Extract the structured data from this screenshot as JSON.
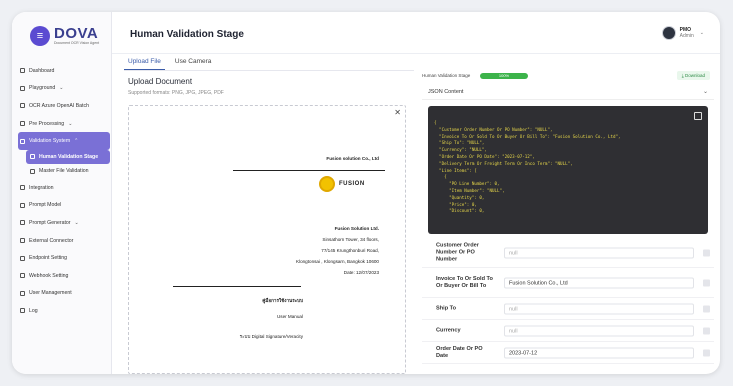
{
  "app": {
    "logo_mark": "≡",
    "logo_name": "DOVA",
    "logo_tag": "Document OCR Vision Agent"
  },
  "sidebar": {
    "items": [
      {
        "label": "Dashboard",
        "icon": "dashboard-icon"
      },
      {
        "label": "Playground",
        "icon": "playground-icon",
        "chevron": "⌄"
      },
      {
        "label": "OCR Azure OpenAI Batch",
        "icon": "batch-icon"
      },
      {
        "label": "Pre Processing",
        "icon": "preprocessing-icon",
        "chevron": "⌄"
      },
      {
        "label": "Validation System",
        "icon": "validation-icon",
        "chevron": "⌃"
      },
      {
        "label": "Human Validation Stage",
        "icon": "human-validation-icon"
      },
      {
        "label": "Master File Validation",
        "icon": "master-file-icon"
      },
      {
        "label": "Integration",
        "icon": "integration-icon"
      },
      {
        "label": "Prompt Model",
        "icon": "prompt-model-icon"
      },
      {
        "label": "Prompt Generator",
        "icon": "prompt-generator-icon",
        "chevron": "⌄"
      },
      {
        "label": "External Connector",
        "icon": "connector-icon"
      },
      {
        "label": "Endpoint Setting",
        "icon": "endpoint-icon"
      },
      {
        "label": "Webhook Setting",
        "icon": "webhook-icon"
      },
      {
        "label": "User Management",
        "icon": "user-icon"
      },
      {
        "label": "Log",
        "icon": "log-icon"
      }
    ]
  },
  "header": {
    "title": "Human Validation Stage",
    "user_name": "PMO",
    "user_role": "Admin",
    "chevron": "⌄"
  },
  "tabs": [
    {
      "label": "Upload File"
    },
    {
      "label": "Use Camera"
    }
  ],
  "upload": {
    "title": "Upload Document",
    "subtitle": "Supported formats: PNG, JPG, JPEG, PDF",
    "close": "✕"
  },
  "document": {
    "company_top": "Fusion solution Co., Ltd",
    "logo_text": "FUSION",
    "company": "Fusion Solution Ltd.",
    "addr1": "Sinsathorn Tower, 34 floors,",
    "addr2": "77/145 Krungthonburi Road,",
    "addr3": "Klongtonsai , Klongsarn, Bangkok 10600",
    "date": "Date: 12/07/2023",
    "thai_title": "คู่มือการใช้งานระบบ",
    "manual": "User Manual",
    "system": "ระบบ Digital Signature/Veracity"
  },
  "right": {
    "stage_label": "Human Validation Stage",
    "progress": "100%",
    "download": "Download",
    "json_title": "JSON Content",
    "json_chev": "⌄",
    "json_text": "{\n  \"Customer Order Number Or PO Number\": \"NULL\",\n  \"Invoice To Or Sold To Or Buyer Or Bill To\": \"Fusion Solution Co., Ltd\",\n  \"Ship To\": \"NULL\",\n  \"Currency\": \"NULL\",\n  \"Order Date Or PO Date\": \"2023-07-12\",\n  \"Delivery Term Or Freight Term Or Inco Term\": \"NULL\",\n  \"Line Items\": [\n    {\n      \"PO Line Number\": 0,\n      \"Item Number\": \"NULL\",\n      \"Quantity\": 0,\n      \"Price\": 0,\n      \"Discount\": 0,"
  },
  "fields": [
    {
      "label": "Customer Order Number Or PO Number",
      "value": "null",
      "placeholder": true
    },
    {
      "label": "Invoice To Or Sold To Or Buyer Or Bill To",
      "value": "Fusion Solution Co., Ltd",
      "placeholder": false
    },
    {
      "label": "Ship To",
      "value": "null",
      "placeholder": true
    },
    {
      "label": "Currency",
      "value": "null",
      "placeholder": true
    },
    {
      "label": "Order Date Or PO Date",
      "value": "2023-07-12",
      "placeholder": false
    }
  ]
}
